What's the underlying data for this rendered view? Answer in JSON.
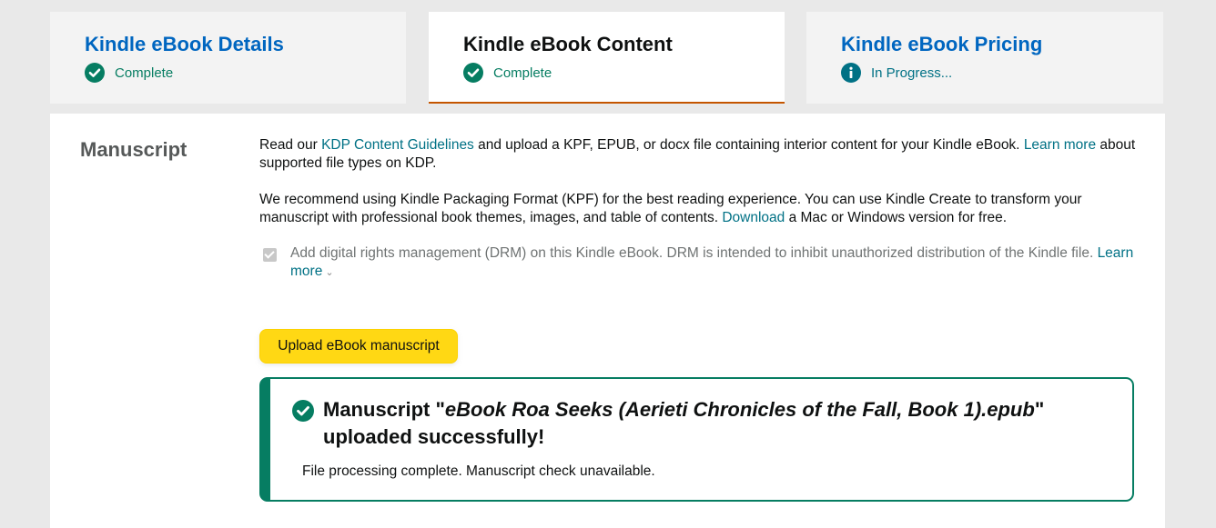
{
  "tabs": [
    {
      "title": "Kindle eBook Details",
      "status": "Complete",
      "status_type": "complete"
    },
    {
      "title": "Kindle eBook Content",
      "status": "Complete",
      "status_type": "complete"
    },
    {
      "title": "Kindle eBook Pricing",
      "status": "In Progress...",
      "status_type": "info"
    }
  ],
  "colors": {
    "link": "#007185",
    "success": "#067d62",
    "accent": "#c45500",
    "button": "#ffd814"
  },
  "manuscript": {
    "section_title": "Manuscript",
    "para1": {
      "t1": "Read our ",
      "link1": "KDP Content Guidelines",
      "t2": " and upload a KPF, EPUB, or docx file containing interior content for your Kindle eBook. ",
      "link2": "Learn more",
      "t3": " about supported file types on KDP."
    },
    "para2": {
      "t1": "We recommend using Kindle Packaging Format (KPF) for the best reading experience. You can use Kindle Create to transform your manuscript with professional book themes, images, and table of contents. ",
      "link": "Download",
      "t2": " a Mac or Windows version for free."
    },
    "drm": {
      "checked": true,
      "text": "Add digital rights management (DRM) on this Kindle eBook. DRM is intended to inhibit unauthorized distribution of the Kindle file. ",
      "link": "Learn more"
    },
    "upload_button": "Upload eBook manuscript",
    "alert": {
      "title_prefix": "Manuscript \"",
      "filename": "eBook Roa Seeks (Aerieti Chronicles of the Fall, Book 1).epub",
      "title_suffix": "\" uploaded successfully!",
      "body": "File processing complete. Manuscript check unavailable."
    }
  }
}
